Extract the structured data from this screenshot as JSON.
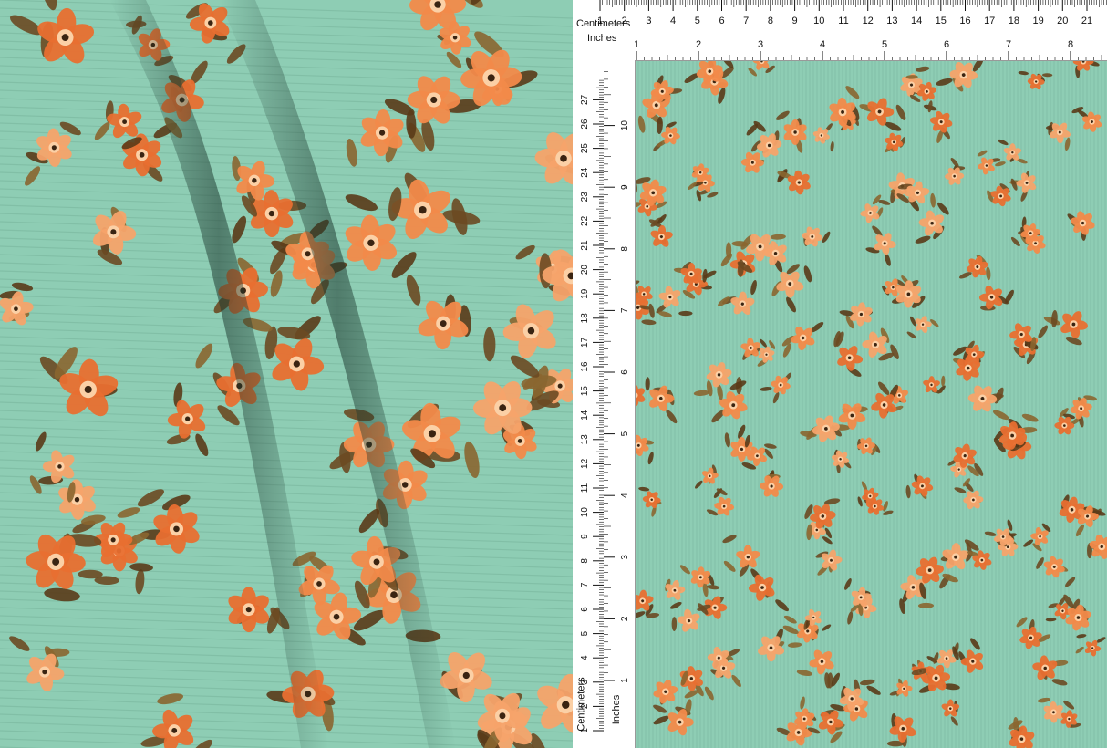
{
  "image": {
    "title": "",
    "fabric": {
      "background_color": "#8ecdb4",
      "rib_shadow_color": "#78b49c",
      "flower_colors": [
        "#f28a4a",
        "#f6a36a",
        "#e86f30",
        "#fbd0a6"
      ],
      "leaf_colors": [
        "#6b4a22",
        "#8a6630",
        "#5a3b18"
      ],
      "flower_center_color": "#3a2412"
    }
  },
  "ruler": {
    "top_units_label": "Centimeters",
    "top_inches_label": "Inches",
    "side_units_label": "Centimeters",
    "side_inches_label": "Inches",
    "top_cm_ticks": [
      "1",
      "2",
      "3",
      "4",
      "5",
      "6",
      "7",
      "8",
      "9",
      "10",
      "11",
      "12",
      "13",
      "14",
      "15",
      "16",
      "17",
      "18",
      "19",
      "20",
      "21"
    ],
    "top_in_ticks": [
      "1",
      "2",
      "3",
      "4",
      "5",
      "6",
      "7",
      "8"
    ],
    "side_cm_ticks": [
      "1",
      "2",
      "3",
      "4",
      "5",
      "6",
      "7",
      "8",
      "9",
      "10",
      "11",
      "12",
      "13",
      "14",
      "15",
      "16",
      "17",
      "18",
      "19",
      "20",
      "21",
      "22",
      "23",
      "24",
      "25",
      "26",
      "27"
    ],
    "side_in_ticks": [
      "1",
      "2",
      "3",
      "4",
      "5",
      "6",
      "7",
      "8",
      "9",
      "10"
    ]
  }
}
